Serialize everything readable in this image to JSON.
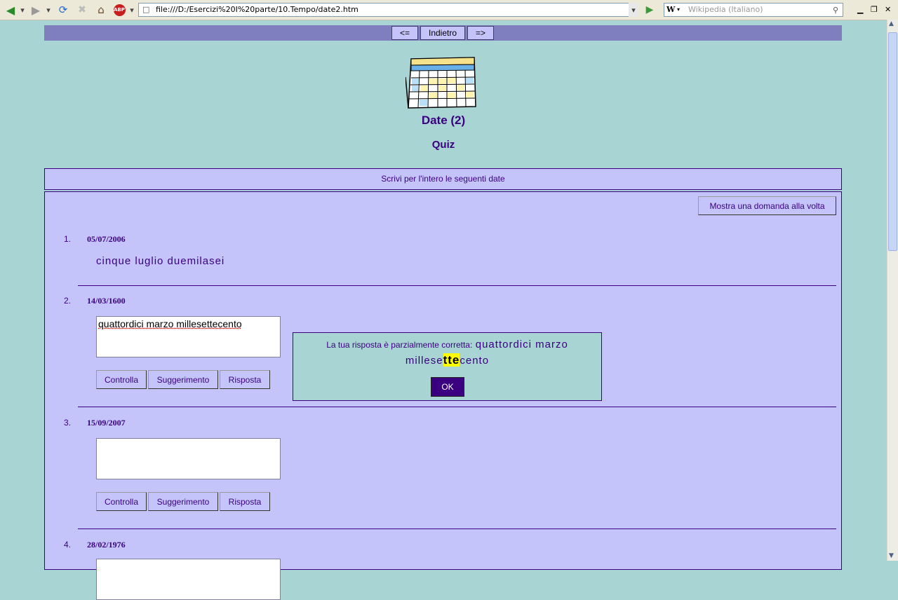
{
  "browser": {
    "url": "file:///D:/Esercizi%20I%20parte/10.Tempo/date2.htm",
    "search_placeholder": "Wikipedia (Italiano)",
    "search_engine_label": "W",
    "abp_label": "ABP"
  },
  "nav": {
    "prev": "<=",
    "back": "Indietro",
    "next": "=>"
  },
  "header": {
    "title": "Date (2)",
    "subtitle": "Quiz"
  },
  "instructions": "Scrivi per l'intero le seguenti date",
  "toggle_button": "Mostra una domanda alla volta",
  "questions": [
    {
      "num": "1.",
      "date": "05/07/2006",
      "answer": "cinque luglio duemilasei"
    },
    {
      "num": "2.",
      "date": "14/03/1600",
      "input": "quattordici marzo millesettecento"
    },
    {
      "num": "3.",
      "date": "15/09/2007",
      "input": ""
    },
    {
      "num": "4.",
      "date": "28/02/1976"
    }
  ],
  "buttons": {
    "check": "Controlla",
    "hint": "Suggerimento",
    "answer": "Risposta"
  },
  "feedback": {
    "intro": "La tua risposta è parzialmente corretta:",
    "part1": "quattordici marzo",
    "part2": "millese",
    "highlight": "tte",
    "part3": "cento",
    "ok": "OK"
  },
  "colors": {
    "accent": "#3a0080",
    "panel": "#c4c4fa",
    "background": "#a8d4d4",
    "highlight": "#ffff00"
  }
}
